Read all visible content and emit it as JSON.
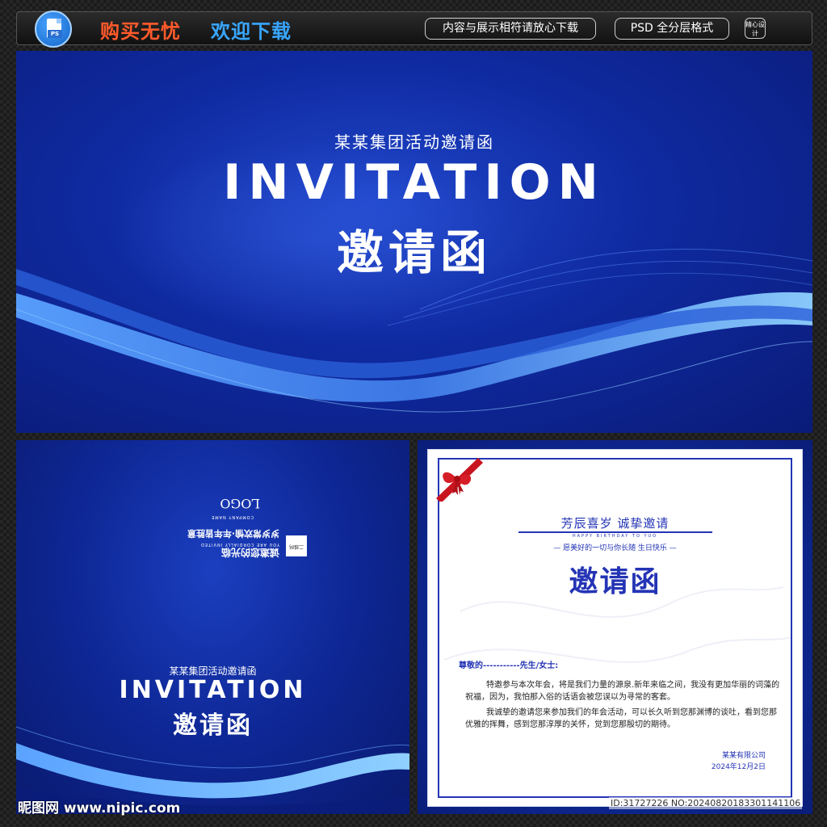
{
  "topbar": {
    "ps_badge": "PS",
    "slogan_primary": "购买无忧",
    "slogan_secondary": "欢迎下载",
    "pill_content_match": "内容与展示相符请放心下载",
    "pill_format": "PSD 全分层格式",
    "fine_design_badge": "精心设计"
  },
  "banner": {
    "subtitle": "某某集团活动邀请函",
    "title_en": "INVITATION",
    "title_cn": "邀请函"
  },
  "back_cover": {
    "line1": "诚邀您的光临",
    "line2": "YOU ARE CORDIALLY INVITED",
    "line3": "岁岁常欢愉·年年皆胜意",
    "qr_label": "二维码",
    "company_en": "COMPANY NAME",
    "logo": "LOGO"
  },
  "square_cover": {
    "subtitle": "某某集团活动邀请函",
    "title_en": "INVITATION",
    "title_cn": "邀请函"
  },
  "letter": {
    "heading": "芳辰喜岁  诚挚邀请",
    "heading_en": "HAPPY BIRTHDAY TO YUO",
    "wish": "— 愿美好的一切与你长随 生日快乐 —",
    "title": "邀请函",
    "greeting": "尊敬的-----------先生/女士:",
    "paragraph1": "特邀参与本次年会，将是我们力量的源泉.新年来临之间，我没有更加华丽的词藻的祝福，因为，我怕那入俗的话语会被您误以为寻常的客套。",
    "paragraph2": "我诚挚的邀请您来参加我们的年会活动，可以长久听到您那渊博的谈吐，看到您那优雅的挥舞，感到您那淳厚的关怀，觉到您那殷切的期待。",
    "company": "某某有限公司",
    "date": "2024年12月2日"
  },
  "watermarks": {
    "site": "昵图网 www.nipic.com",
    "id": "ID:31727226 NO:20240820183301141106"
  },
  "colors": {
    "banner_blue": "#0f2aa0",
    "wave_light": "#7ec3ff",
    "letter_accent": "#2434b5",
    "slogan_orange": "#ff5a2b",
    "slogan_blue": "#38a6ff"
  }
}
